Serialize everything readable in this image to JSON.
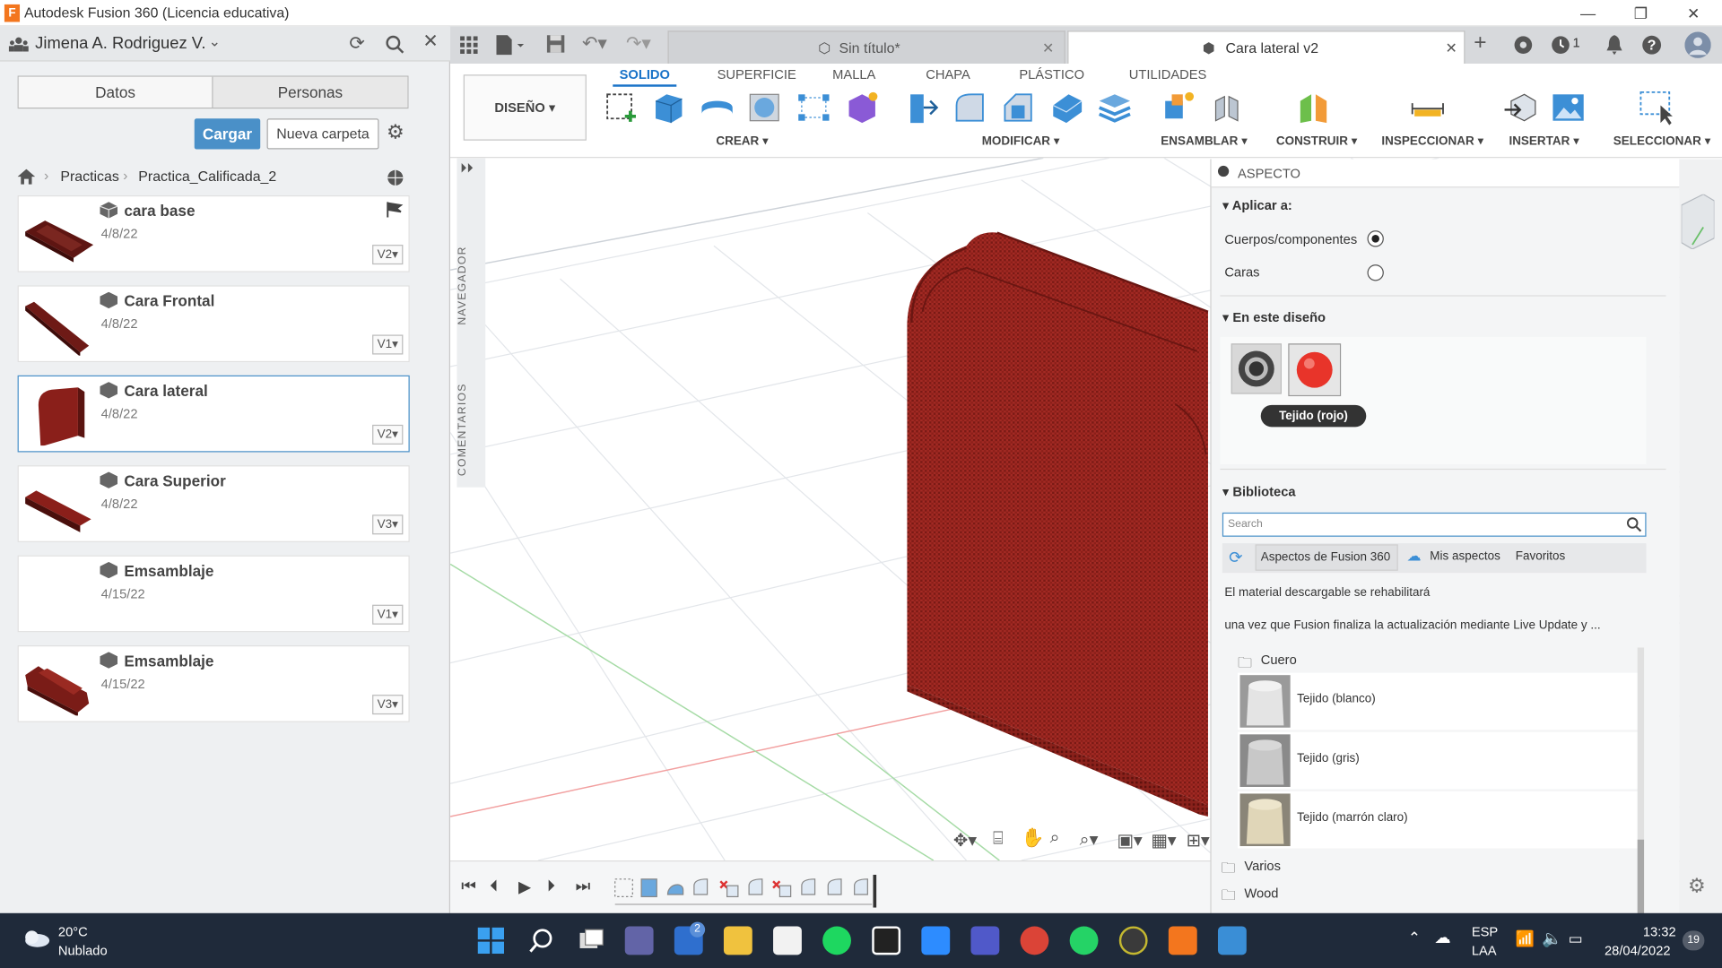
{
  "window": {
    "title": "Autodesk Fusion 360 (Licencia educativa)"
  },
  "user": {
    "name": "Jimena A. Rodriguez V."
  },
  "data_panel": {
    "tabs": [
      "Datos",
      "Personas"
    ],
    "upload_label": "Cargar",
    "new_folder_label": "Nueva carpeta",
    "breadcrumb": [
      "Practicas",
      "Practica_Calificada_2"
    ],
    "files": [
      {
        "name": "cara base",
        "date": "4/8/22",
        "version": "V2"
      },
      {
        "name": "Cara Frontal",
        "date": "4/8/22",
        "version": "V1"
      },
      {
        "name": "Cara lateral",
        "date": "4/8/22",
        "version": "V2"
      },
      {
        "name": "Cara Superior",
        "date": "4/8/22",
        "version": "V3"
      },
      {
        "name": "Emsamblaje",
        "date": "4/15/22",
        "version": "V1"
      },
      {
        "name": "Emsamblaje",
        "date": "4/15/22",
        "version": "V3"
      }
    ]
  },
  "doc_tabs": [
    {
      "name": "Sin título*"
    },
    {
      "name": "Cara lateral v2"
    }
  ],
  "toolbar": {
    "notif_count": "1",
    "workspace": "DISEÑO",
    "tabs": [
      "SOLIDO",
      "SUPERFICIE",
      "MALLA",
      "CHAPA",
      "PLÁSTICO",
      "UTILIDADES"
    ],
    "groups": [
      "CREAR",
      "MODIFICAR",
      "ENSAMBLAR",
      "CONSTRUIR",
      "INSPECCIONAR",
      "INSERTAR",
      "SELECCIONAR"
    ]
  },
  "side_labels": {
    "navigator": "NAVEGADOR",
    "comments": "COMENTARIOS"
  },
  "appearance_panel": {
    "title": "ASPECTO",
    "apply_to_label": "Aplicar a:",
    "option_bodies": "Cuerpos/componentes",
    "option_faces": "Caras",
    "in_design_label": "En este diseño",
    "tooltip": "Tejido (rojo)",
    "library_label": "Biblioteca",
    "search_placeholder": "Search",
    "lib_tabs": [
      "Aspectos de Fusion 360",
      "Mis aspectos",
      "Favoritos"
    ],
    "note1": "El material descargable se rehabilitará",
    "note2": "una vez que Fusion finaliza la actualización mediante Live Update y ...",
    "folders": [
      "Cuero",
      "Varios",
      "Wood"
    ],
    "materials": [
      "Tejido (blanco)",
      "Tejido (gris)",
      "Tejido (marrón claro)"
    ]
  },
  "taskbar": {
    "temp": "20°C",
    "weather": "Nublado",
    "lang1": "ESP",
    "lang2": "LAA",
    "time": "13:32",
    "date": "28/04/2022",
    "mail_badge": "2",
    "notif_badge": "19"
  },
  "colors": {
    "accent": "#1a73c8",
    "fabric_red": "#a32a24",
    "button_blue": "#4a90c8"
  }
}
